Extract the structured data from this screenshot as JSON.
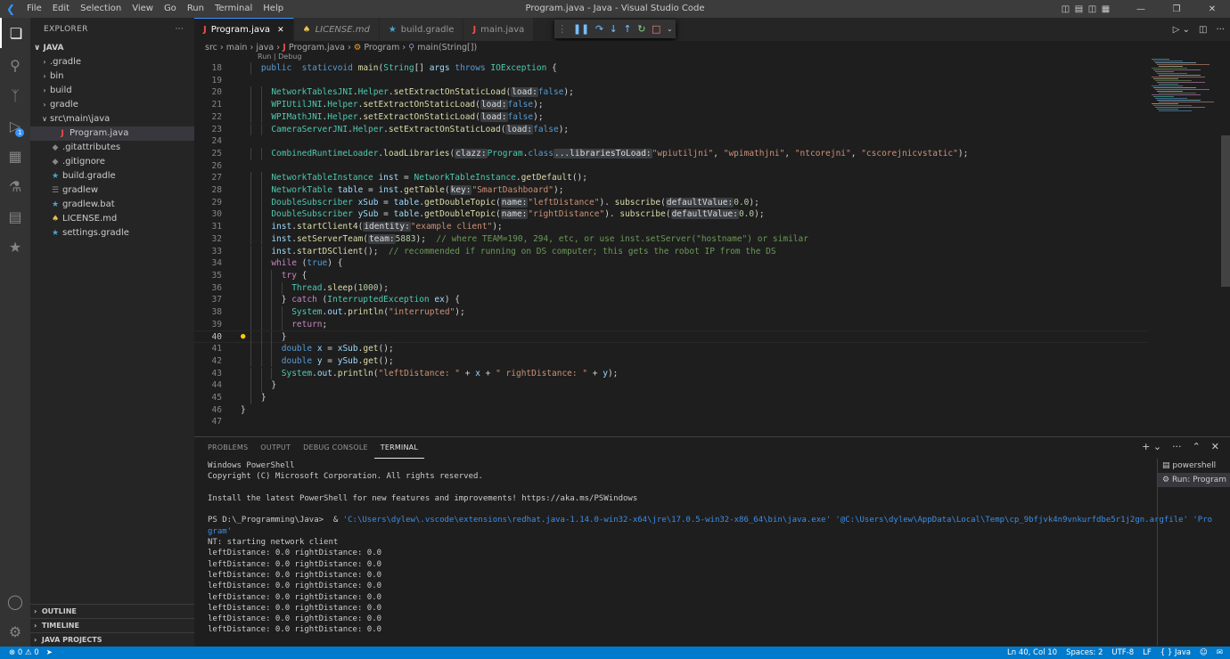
{
  "window": {
    "title": "Program.java - Java - Visual Studio Code"
  },
  "menu": [
    "File",
    "Edit",
    "Selection",
    "View",
    "Go",
    "Run",
    "Terminal",
    "Help"
  ],
  "sidebar": {
    "header": "EXPLORER",
    "root": "JAVA",
    "tree": [
      {
        "label": ".gradle",
        "type": "folder",
        "indent": 1
      },
      {
        "label": "bin",
        "type": "folder",
        "indent": 1
      },
      {
        "label": "build",
        "type": "folder",
        "indent": 1
      },
      {
        "label": "gradle",
        "type": "folder",
        "indent": 1
      },
      {
        "label": "src\\main\\java",
        "type": "folder-open",
        "indent": 1
      },
      {
        "label": "Program.java",
        "type": "java",
        "indent": 2,
        "selected": true
      },
      {
        "label": ".gitattributes",
        "type": "git",
        "indent": 1
      },
      {
        "label": ".gitignore",
        "type": "git",
        "indent": 1
      },
      {
        "label": "build.gradle",
        "type": "gradle",
        "indent": 1
      },
      {
        "label": "gradlew",
        "type": "file",
        "indent": 1
      },
      {
        "label": "gradlew.bat",
        "type": "gradle",
        "indent": 1
      },
      {
        "label": "LICENSE.md",
        "type": "license",
        "indent": 1
      },
      {
        "label": "settings.gradle",
        "type": "gradle",
        "indent": 1
      }
    ],
    "bottom_sections": [
      "OUTLINE",
      "TIMELINE",
      "JAVA PROJECTS"
    ]
  },
  "activity": {
    "run_badge": "1"
  },
  "tabs": [
    {
      "label": "Program.java",
      "icon": "J",
      "active": true
    },
    {
      "label": "LICENSE.md",
      "icon": "license",
      "active": false
    },
    {
      "label": "build.gradle",
      "icon": "gradle",
      "active": false
    },
    {
      "label": "main.java",
      "icon": "J",
      "active": false
    }
  ],
  "breadcrumb": [
    "src",
    "main",
    "java",
    "Program.java",
    "Program",
    "main(String[])"
  ],
  "editor": {
    "codelens": "Run | Debug",
    "current_line": 40,
    "lines": [
      {
        "n": 18,
        "i": 2,
        "t": [
          [
            "kw",
            "public"
          ],
          [
            "",
            "  "
          ],
          [
            "kw",
            "static"
          ],
          [
            "",
            ""
          ],
          [
            "kw",
            "void"
          ],
          [
            "",
            " "
          ],
          [
            "fn",
            "main"
          ],
          [
            "",
            "("
          ],
          [
            "ty",
            "String"
          ],
          [
            "",
            "[] "
          ],
          [
            "var",
            "args"
          ],
          [
            "",
            " "
          ],
          [
            "kw",
            "throws"
          ],
          [
            "",
            " "
          ],
          [
            "ty",
            "IOException"
          ],
          [
            "",
            " {"
          ]
        ]
      },
      {
        "n": 19,
        "i": 0,
        "t": []
      },
      {
        "n": 20,
        "i": 3,
        "t": [
          [
            "ty",
            "NetworkTablesJNI"
          ],
          [
            "",
            "."
          ],
          [
            "ty",
            "Helper"
          ],
          [
            "",
            "."
          ],
          [
            "fn",
            "setExtractOnStaticLoad"
          ],
          [
            "",
            "("
          ],
          [
            "hint",
            "load:"
          ],
          [
            "kw",
            "false"
          ],
          [
            "",
            ");"
          ]
        ]
      },
      {
        "n": 21,
        "i": 3,
        "t": [
          [
            "ty",
            "WPIUtilJNI"
          ],
          [
            "",
            "."
          ],
          [
            "ty",
            "Helper"
          ],
          [
            "",
            "."
          ],
          [
            "fn",
            "setExtractOnStaticLoad"
          ],
          [
            "",
            "("
          ],
          [
            "hint",
            "load:"
          ],
          [
            "kw",
            "false"
          ],
          [
            "",
            ");"
          ]
        ]
      },
      {
        "n": 22,
        "i": 3,
        "t": [
          [
            "ty",
            "WPIMathJNI"
          ],
          [
            "",
            "."
          ],
          [
            "ty",
            "Helper"
          ],
          [
            "",
            "."
          ],
          [
            "fn",
            "setExtractOnStaticLoad"
          ],
          [
            "",
            "("
          ],
          [
            "hint",
            "load:"
          ],
          [
            "kw",
            "false"
          ],
          [
            "",
            ");"
          ]
        ]
      },
      {
        "n": 23,
        "i": 3,
        "t": [
          [
            "ty",
            "CameraServerJNI"
          ],
          [
            "",
            "."
          ],
          [
            "ty",
            "Helper"
          ],
          [
            "",
            "."
          ],
          [
            "fn",
            "setExtractOnStaticLoad"
          ],
          [
            "",
            "("
          ],
          [
            "hint",
            "load:"
          ],
          [
            "kw",
            "false"
          ],
          [
            "",
            ");"
          ]
        ]
      },
      {
        "n": 24,
        "i": 0,
        "t": []
      },
      {
        "n": 25,
        "i": 3,
        "t": [
          [
            "ty",
            "CombinedRuntimeLoader"
          ],
          [
            "",
            "."
          ],
          [
            "fn",
            "loadLibraries"
          ],
          [
            "",
            "("
          ],
          [
            "hint",
            "clazz:"
          ],
          [
            "ty",
            "Program"
          ],
          [
            "",
            "."
          ],
          [
            "kw",
            "class"
          ],
          [
            ", "
          ],
          [
            "hint",
            "...librariesToLoad:"
          ],
          [
            "str",
            "\"wpiutiljni\""
          ],
          [
            "",
            ", "
          ],
          [
            "str",
            "\"wpimathjni\""
          ],
          [
            "",
            ", "
          ],
          [
            "str",
            "\"ntcorejni\""
          ],
          [
            "",
            ", "
          ],
          [
            "str",
            "\"cscorejnicvstatic\""
          ],
          [
            "",
            ");"
          ]
        ]
      },
      {
        "n": 26,
        "i": 0,
        "t": []
      },
      {
        "n": 27,
        "i": 3,
        "t": [
          [
            "ty",
            "NetworkTableInstance"
          ],
          [
            "",
            " "
          ],
          [
            "var",
            "inst"
          ],
          [
            "",
            " = "
          ],
          [
            "ty",
            "NetworkTableInstance"
          ],
          [
            "",
            "."
          ],
          [
            "fn",
            "getDefault"
          ],
          [
            "",
            "();"
          ]
        ]
      },
      {
        "n": 28,
        "i": 3,
        "t": [
          [
            "ty",
            "NetworkTable"
          ],
          [
            "",
            " "
          ],
          [
            "var",
            "table"
          ],
          [
            "",
            " = "
          ],
          [
            "var",
            "inst"
          ],
          [
            "",
            "."
          ],
          [
            "fn",
            "getTable"
          ],
          [
            "",
            "("
          ],
          [
            "hint",
            "key:"
          ],
          [
            "str",
            "\"SmartDashboard\""
          ],
          [
            "",
            ");"
          ]
        ]
      },
      {
        "n": 29,
        "i": 3,
        "t": [
          [
            "ty",
            "DoubleSubscriber"
          ],
          [
            "",
            " "
          ],
          [
            "var",
            "xSub"
          ],
          [
            "",
            " = "
          ],
          [
            "var",
            "table"
          ],
          [
            "",
            "."
          ],
          [
            "fn",
            "getDoubleTopic"
          ],
          [
            "",
            "("
          ],
          [
            "hint",
            "name:"
          ],
          [
            "str",
            "\"leftDistance\""
          ],
          [
            "",
            "). "
          ],
          [
            "fn",
            "subscribe"
          ],
          [
            "",
            "("
          ],
          [
            "hint",
            "defaultValue:"
          ],
          [
            "num",
            "0.0"
          ],
          [
            "",
            ");"
          ]
        ]
      },
      {
        "n": 30,
        "i": 3,
        "t": [
          [
            "ty",
            "DoubleSubscriber"
          ],
          [
            "",
            " "
          ],
          [
            "var",
            "ySub"
          ],
          [
            "",
            " = "
          ],
          [
            "var",
            "table"
          ],
          [
            "",
            "."
          ],
          [
            "fn",
            "getDoubleTopic"
          ],
          [
            "",
            "("
          ],
          [
            "hint",
            "name:"
          ],
          [
            "str",
            "\"rightDistance\""
          ],
          [
            "",
            "). "
          ],
          [
            "fn",
            "subscribe"
          ],
          [
            "",
            "("
          ],
          [
            "hint",
            "defaultValue:"
          ],
          [
            "num",
            "0.0"
          ],
          [
            "",
            ");"
          ]
        ]
      },
      {
        "n": 31,
        "i": 3,
        "t": [
          [
            "var",
            "inst"
          ],
          [
            "",
            "."
          ],
          [
            "fn",
            "startClient4"
          ],
          [
            "",
            "("
          ],
          [
            "hint",
            "identity:"
          ],
          [
            "str",
            "\"example client\""
          ],
          [
            "",
            ");"
          ]
        ]
      },
      {
        "n": 32,
        "i": 3,
        "t": [
          [
            "var",
            "inst"
          ],
          [
            "",
            "."
          ],
          [
            "fn",
            "setServerTeam"
          ],
          [
            "",
            "("
          ],
          [
            "hint",
            "team:"
          ],
          [
            "num",
            "5883"
          ],
          [
            "",
            ");  "
          ],
          [
            "cm",
            "// where TEAM=190, 294, etc, or use inst.setServer(\"hostname\") or similar"
          ]
        ]
      },
      {
        "n": 33,
        "i": 3,
        "t": [
          [
            "var",
            "inst"
          ],
          [
            "",
            "."
          ],
          [
            "fn",
            "startDSClient"
          ],
          [
            "",
            "();  "
          ],
          [
            "cm",
            "// recommended if running on DS computer; this gets the robot IP from the DS"
          ]
        ]
      },
      {
        "n": 34,
        "i": 3,
        "t": [
          [
            "ctl",
            "while"
          ],
          [
            "",
            " ("
          ],
          [
            "kw",
            "true"
          ],
          [
            "",
            ") {"
          ]
        ]
      },
      {
        "n": 35,
        "i": 4,
        "t": [
          [
            "ctl",
            "try"
          ],
          [
            "",
            " {"
          ]
        ]
      },
      {
        "n": 36,
        "i": 5,
        "t": [
          [
            "ty",
            "Thread"
          ],
          [
            "",
            "."
          ],
          [
            "fn",
            "sleep"
          ],
          [
            "",
            "("
          ],
          [
            "num",
            "1000"
          ],
          [
            "",
            ");"
          ]
        ]
      },
      {
        "n": 37,
        "i": 4,
        "t": [
          [
            "",
            "} "
          ],
          [
            "ctl",
            "catch"
          ],
          [
            "",
            " ("
          ],
          [
            "ty",
            "InterruptedException"
          ],
          [
            "",
            " "
          ],
          [
            "var",
            "ex"
          ],
          [
            "",
            ") {"
          ]
        ]
      },
      {
        "n": 38,
        "i": 5,
        "t": [
          [
            "ty",
            "System"
          ],
          [
            "",
            "."
          ],
          [
            "var",
            "out"
          ],
          [
            "",
            "."
          ],
          [
            "fn",
            "println"
          ],
          [
            "",
            "("
          ],
          [
            "str",
            "\"interrupted\""
          ],
          [
            "",
            ");"
          ]
        ]
      },
      {
        "n": 39,
        "i": 5,
        "t": [
          [
            "ctl",
            "return"
          ],
          [
            "",
            ";"
          ]
        ]
      },
      {
        "n": 40,
        "i": 4,
        "t": [
          [
            "",
            "}"
          ]
        ]
      },
      {
        "n": 41,
        "i": 4,
        "t": [
          [
            "kw",
            "double"
          ],
          [
            "",
            " "
          ],
          [
            "var",
            "x"
          ],
          [
            "",
            " = "
          ],
          [
            "var",
            "xSub"
          ],
          [
            "",
            "."
          ],
          [
            "fn",
            "get"
          ],
          [
            "",
            "();"
          ]
        ]
      },
      {
        "n": 42,
        "i": 4,
        "t": [
          [
            "kw",
            "double"
          ],
          [
            "",
            " "
          ],
          [
            "var",
            "y"
          ],
          [
            "",
            " = "
          ],
          [
            "var",
            "ySub"
          ],
          [
            "",
            "."
          ],
          [
            "fn",
            "get"
          ],
          [
            "",
            "();"
          ]
        ]
      },
      {
        "n": 43,
        "i": 4,
        "t": [
          [
            "ty",
            "System"
          ],
          [
            "",
            "."
          ],
          [
            "var",
            "out"
          ],
          [
            "",
            "."
          ],
          [
            "fn",
            "println"
          ],
          [
            "",
            "("
          ],
          [
            "str",
            "\"leftDistance: \""
          ],
          [
            "",
            " + "
          ],
          [
            "var",
            "x"
          ],
          [
            "",
            " + "
          ],
          [
            "str",
            "\" rightDistance: \""
          ],
          [
            "",
            " + "
          ],
          [
            "var",
            "y"
          ],
          [
            "",
            ");"
          ]
        ]
      },
      {
        "n": 44,
        "i": 3,
        "t": [
          [
            "",
            "}"
          ]
        ]
      },
      {
        "n": 45,
        "i": 2,
        "t": [
          [
            "",
            "}"
          ]
        ]
      },
      {
        "n": 46,
        "i": 0,
        "t": [
          [
            "",
            "}"
          ]
        ]
      },
      {
        "n": 47,
        "i": 0,
        "t": []
      }
    ]
  },
  "panel": {
    "tabs": [
      "PROBLEMS",
      "OUTPUT",
      "DEBUG CONSOLE",
      "TERMINAL"
    ],
    "active_tab": "TERMINAL",
    "terminal_lines": [
      {
        "t": "Windows PowerShell"
      },
      {
        "t": "Copyright (C) Microsoft Corporation. All rights reserved."
      },
      {
        "t": ""
      },
      {
        "t": "Install the latest PowerShell for new features and improvements! https://aka.ms/PSWindows"
      },
      {
        "t": ""
      },
      {
        "t": "PS D:\\_Programming\\Java>  & ",
        "cmd": "'C:\\Users\\dylew\\.vscode\\extensions\\redhat.java-1.14.0-win32-x64\\jre\\17.0.5-win32-x86_64\\bin\\java.exe' '@C:\\Users\\dylew\\AppData\\Local\\Temp\\cp_9bfjvk4n9vnkurfdbe5r1j2gn.argfile' 'Pro"
      },
      {
        "t": "",
        "cmd": "gram'"
      },
      {
        "t": "NT: starting network client"
      },
      {
        "t": "leftDistance: 0.0 rightDistance: 0.0"
      },
      {
        "t": "leftDistance: 0.0 rightDistance: 0.0"
      },
      {
        "t": "leftDistance: 0.0 rightDistance: 0.0"
      },
      {
        "t": "leftDistance: 0.0 rightDistance: 0.0"
      },
      {
        "t": "leftDistance: 0.0 rightDistance: 0.0"
      },
      {
        "t": "leftDistance: 0.0 rightDistance: 0.0"
      },
      {
        "t": "leftDistance: 0.0 rightDistance: 0.0"
      },
      {
        "t": "leftDistance: 0.0 rightDistance: 0.0"
      }
    ],
    "terminals": [
      {
        "label": "powershell",
        "selected": false
      },
      {
        "label": "Run: Program",
        "selected": true
      }
    ]
  },
  "status": {
    "errors": "0",
    "warnings": "0",
    "position": "Ln 40, Col 10",
    "spaces": "Spaces: 2",
    "encoding": "UTF-8",
    "eol": "LF",
    "language": "Java",
    "language_braces": "{ }"
  },
  "colors": {
    "accent": "#007acc",
    "active_tab_border": "#3794ff"
  }
}
